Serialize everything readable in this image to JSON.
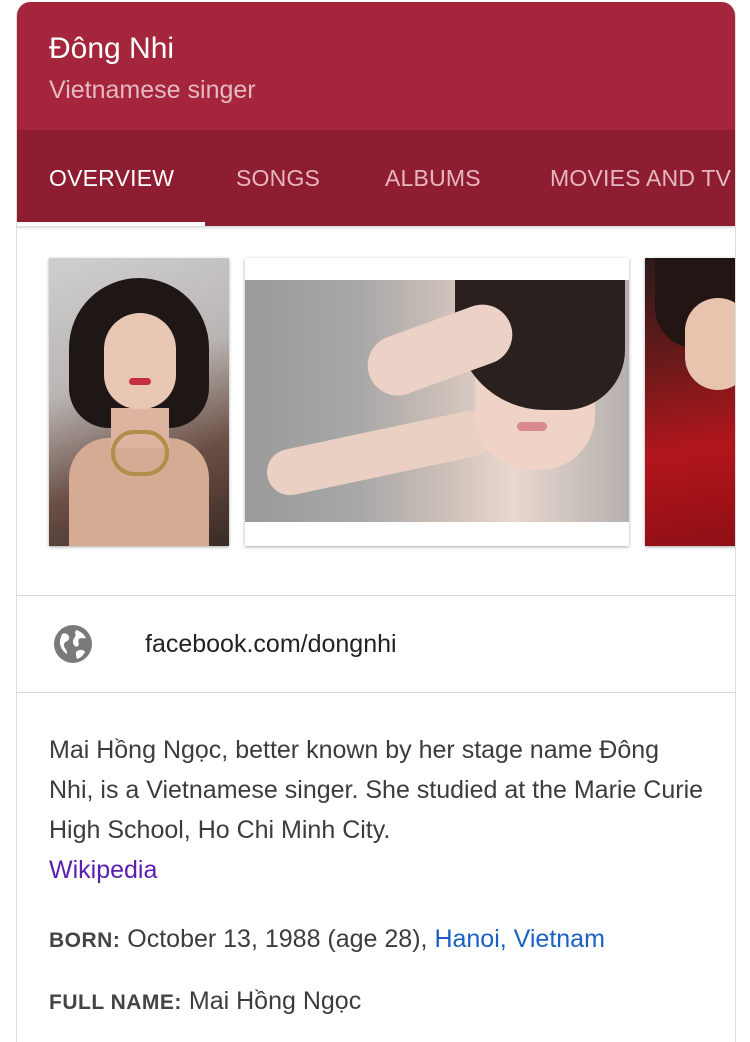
{
  "header": {
    "title": "Đông Nhi",
    "subtitle": "Vietnamese singer"
  },
  "tabs": [
    {
      "label": "OVERVIEW",
      "active": true
    },
    {
      "label": "SONGS",
      "active": false
    },
    {
      "label": "ALBUMS",
      "active": false
    },
    {
      "label": "MOVIES AND TV",
      "active": false
    }
  ],
  "photos": [
    {
      "name": "photo-1"
    },
    {
      "name": "photo-2"
    },
    {
      "name": "photo-3"
    }
  ],
  "website": {
    "icon": "globe-icon",
    "text": "facebook.com/dongnhi"
  },
  "description": {
    "text": "Mai Hồng Ngọc, better known by her stage name Đông Nhi, is a Vietnamese singer. She studied at the Marie Curie High School, Ho Chi Minh City.",
    "source": "Wikipedia"
  },
  "facts": {
    "born": {
      "label": "BORN:",
      "value": "October 13, 1988 (age 28),",
      "place": "Hanoi, Vietnam"
    },
    "full_name": {
      "label": "FULL NAME:",
      "value": "Mai Hồng Ngọc"
    }
  },
  "colors": {
    "header": "#a4253c",
    "tabs": "#8f1d31",
    "link": "#1a5fc4",
    "visited_link": "#5a1eb0"
  }
}
